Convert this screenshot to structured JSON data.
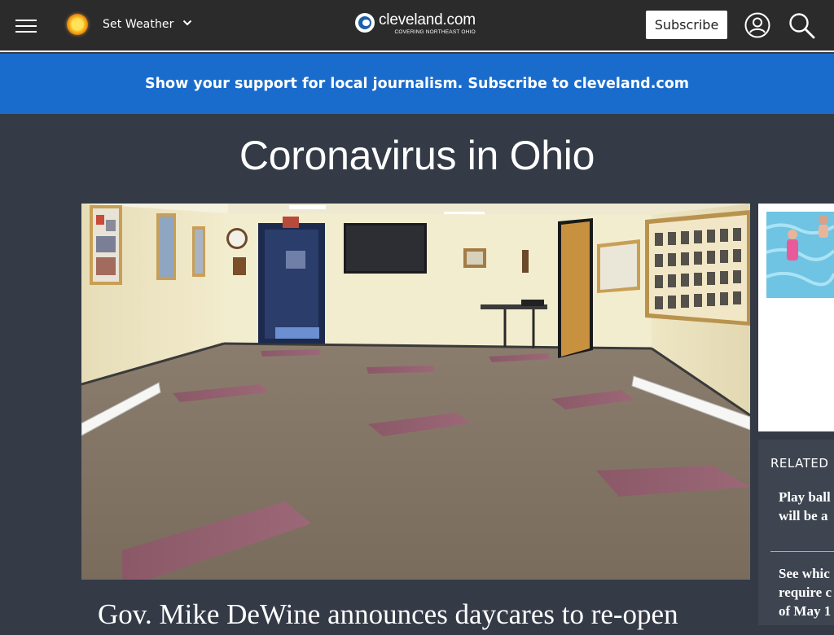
{
  "header": {
    "weather_label": "Set Weather",
    "logo_name": "cleveland.com",
    "logo_tagline": "COVERING NORTHEAST OHIO",
    "subscribe_label": "Subscribe",
    "icons": [
      "menu-icon",
      "sun-icon",
      "chevron-down-icon",
      "user-icon",
      "search-icon"
    ]
  },
  "banner": {
    "text": "Show your support for local journalism. Subscribe to cleveland.com",
    "color": "#1a6ccc"
  },
  "section": {
    "title": "Coronavirus in Ohio"
  },
  "article": {
    "headline": "Gov. Mike DeWine announces daycares to re-open"
  },
  "related": {
    "heading": "RELATED",
    "items": [
      {
        "line1": "Play ball",
        "line2": "will be a"
      },
      {
        "line1": "See whic",
        "line2": "require c",
        "line3": "of May 1"
      }
    ]
  },
  "colors": {
    "page_background": "#343b47",
    "topbar": "#2b2b2b",
    "accent": "#1a6ccc"
  }
}
